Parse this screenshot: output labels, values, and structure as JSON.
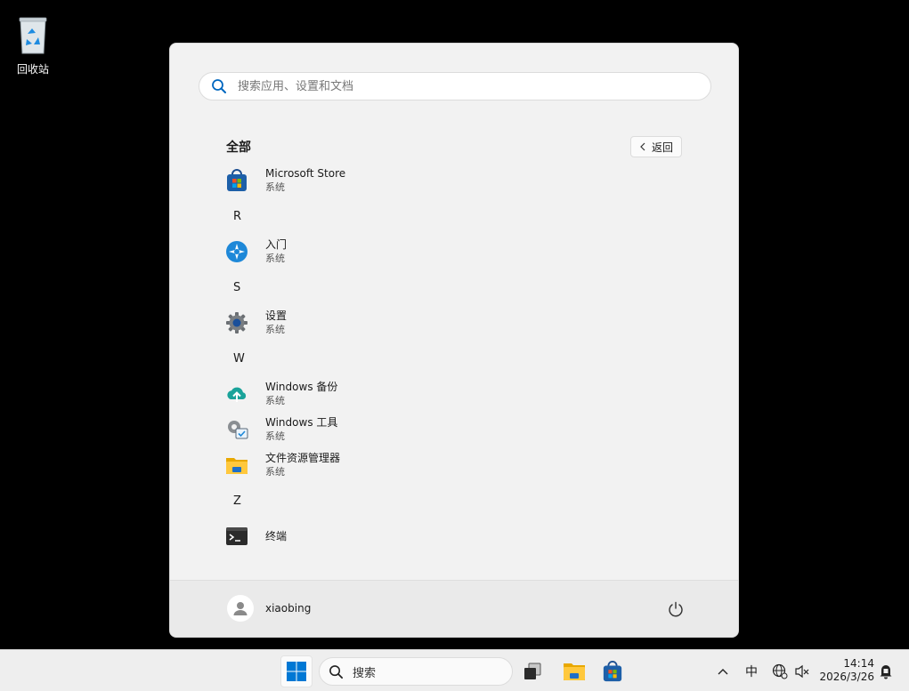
{
  "desktop": {
    "recycle_bin_label": "回收站"
  },
  "start_menu": {
    "search_placeholder": "搜索应用、设置和文档",
    "all_title": "全部",
    "back_label": "返回",
    "apps": [
      {
        "type": "app",
        "icon": "microsoft-store-icon",
        "name": "Microsoft Store",
        "sub": "系统"
      },
      {
        "type": "letter",
        "name": "R"
      },
      {
        "type": "app",
        "icon": "get-started-icon",
        "name": "入门",
        "sub": "系统"
      },
      {
        "type": "letter",
        "name": "S"
      },
      {
        "type": "app",
        "icon": "settings-gear-icon",
        "name": "设置",
        "sub": "系统"
      },
      {
        "type": "letter",
        "name": "W"
      },
      {
        "type": "app",
        "icon": "windows-backup-icon",
        "name": "Windows 备份",
        "sub": "系统"
      },
      {
        "type": "app",
        "icon": "windows-tools-icon",
        "name": "Windows 工具",
        "sub": "系统"
      },
      {
        "type": "app",
        "icon": "file-explorer-icon",
        "name": "文件资源管理器",
        "sub": "系统"
      },
      {
        "type": "letter",
        "name": "Z"
      },
      {
        "type": "app",
        "icon": "terminal-icon",
        "name": "终端",
        "sub": ""
      }
    ],
    "user_name": "xiaobing"
  },
  "taskbar": {
    "search_label": "搜索",
    "ime_label": "中",
    "time": "14:14",
    "date": "2026/3/26"
  },
  "colors": {
    "accent": "#0078d4",
    "desktop_bg": "#000000",
    "start_bg": "#f2f2f2"
  }
}
